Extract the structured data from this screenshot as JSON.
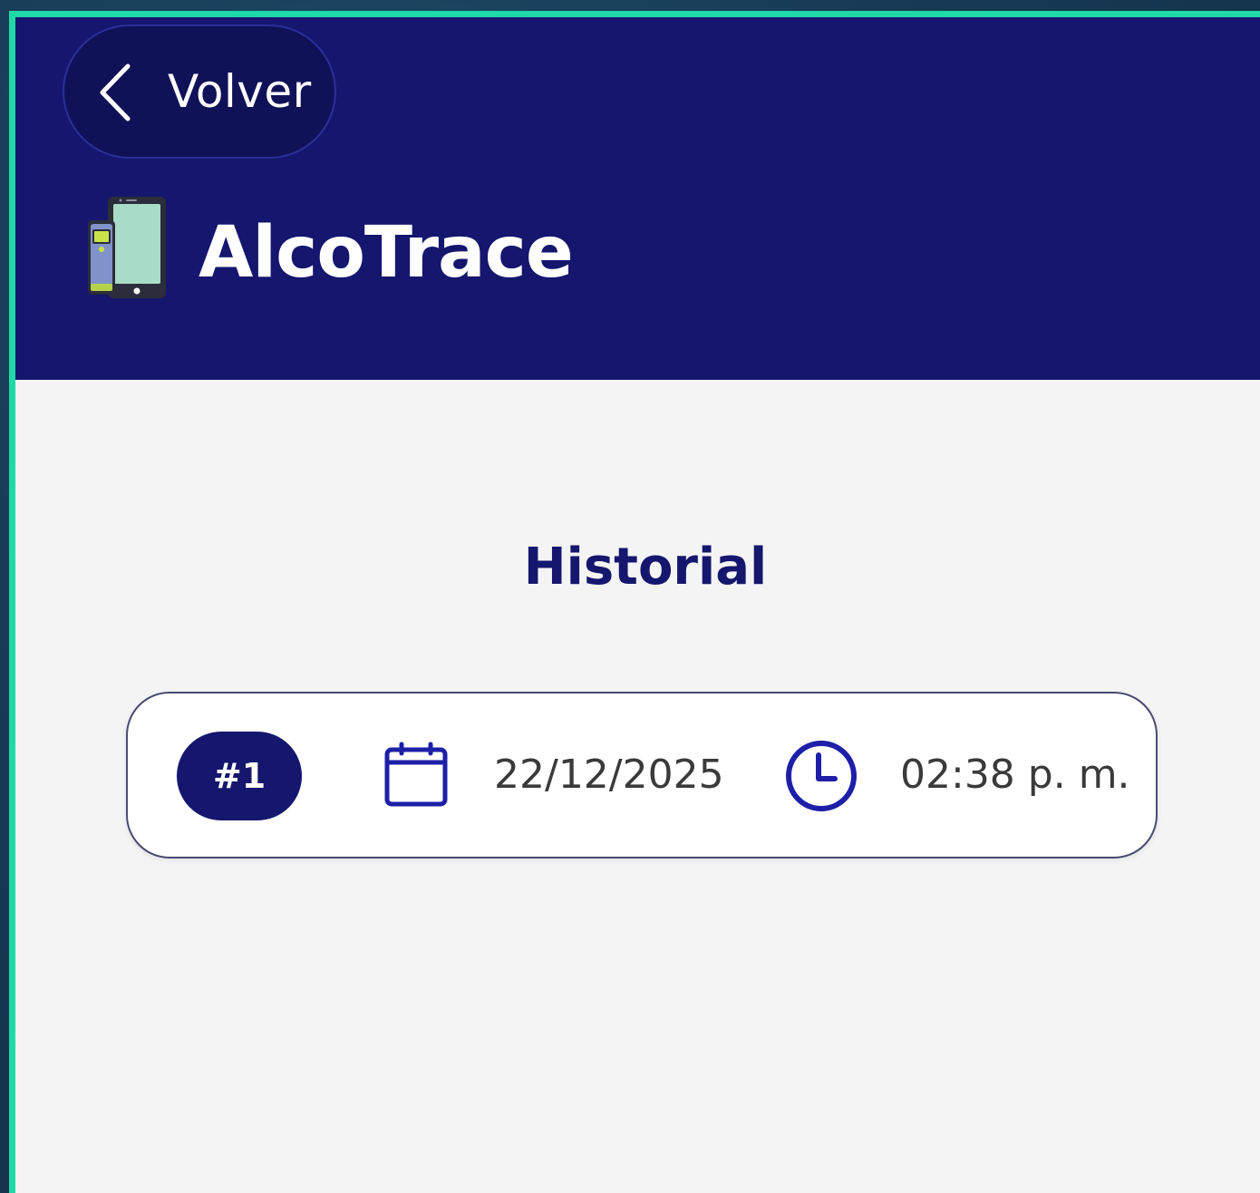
{
  "header": {
    "back_label": "Volver",
    "app_title": "AlcoTrace",
    "logo_icon": "breathalyzer-phone-logo-icon",
    "background_color": "#15166d"
  },
  "main": {
    "section_title": "Historial",
    "records": [
      {
        "badge": "#1",
        "date": "22/12/2025",
        "time": "02:38 p. m."
      }
    ]
  },
  "icons": {
    "back": "chevron-left-icon",
    "date": "calendar-icon",
    "time": "clock-icon"
  },
  "colors": {
    "primary": "#15166d",
    "frame_accent": "#1fd9a6",
    "card_background": "#ffffff",
    "page_background": "#f4f4f5"
  }
}
